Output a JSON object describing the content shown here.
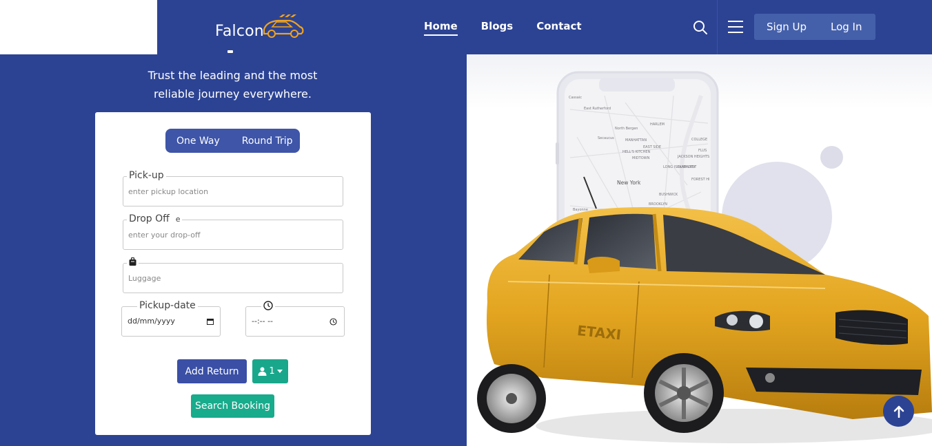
{
  "brand": {
    "name": "Falcon",
    "logo_icon": "car-logo-icon"
  },
  "nav": {
    "links": [
      {
        "label": "Home",
        "active": true
      },
      {
        "label": "Blogs",
        "active": false
      },
      {
        "label": "Contact",
        "active": false
      }
    ],
    "search_icon": "search-icon",
    "menu_icon": "hamburger-menu-icon",
    "signup_label": "Sign Up",
    "login_label": "Log In"
  },
  "hero": {
    "tagline_line1": "Trust the leading and the most",
    "tagline_line2": "reliable journey everywhere."
  },
  "booking": {
    "trip_types": {
      "one_way": "One Way",
      "round_trip": "Round Trip"
    },
    "pickup": {
      "label": "Pick-up",
      "placeholder": "enter pickup location"
    },
    "dropoff": {
      "label": "Drop Off",
      "label_suffix": "e",
      "placeholder": "enter your drop-off"
    },
    "luggage": {
      "icon": "luggage-icon",
      "placeholder": "Luggage"
    },
    "pickup_date": {
      "label": "Pickup-date",
      "value": "dd/mm/yyyy",
      "icon": "calendar-icon"
    },
    "pickup_time": {
      "icon": "clock-icon",
      "value": "--:-- --"
    },
    "add_return_label": "Add Return",
    "passengers": {
      "icon": "user-icon",
      "value": "1"
    },
    "search_label": "Search Booking"
  },
  "illustration": {
    "car_text": "ETAXI",
    "map_labels": [
      "Cassaic",
      "East Rutherford",
      "North Bergen",
      "Secaucus",
      "HARLEM",
      "MANHATTAN",
      "EAST SIDE",
      "HELL'S KITCHEN",
      "MIDTOWN",
      "JACKSON HEIGHTS",
      "ELMHURST",
      "New York",
      "BUSHWICK",
      "BROOKLYN",
      "Bayonne",
      "FOREST HI",
      "COLLEGE",
      "FLUS",
      "LONG ISLAND CITY"
    ]
  },
  "colors": {
    "primary": "#2c4394",
    "accent_green": "#18ab8c",
    "taxi_yellow": "#e3a520"
  },
  "scroll_top_icon": "arrow-up-icon"
}
